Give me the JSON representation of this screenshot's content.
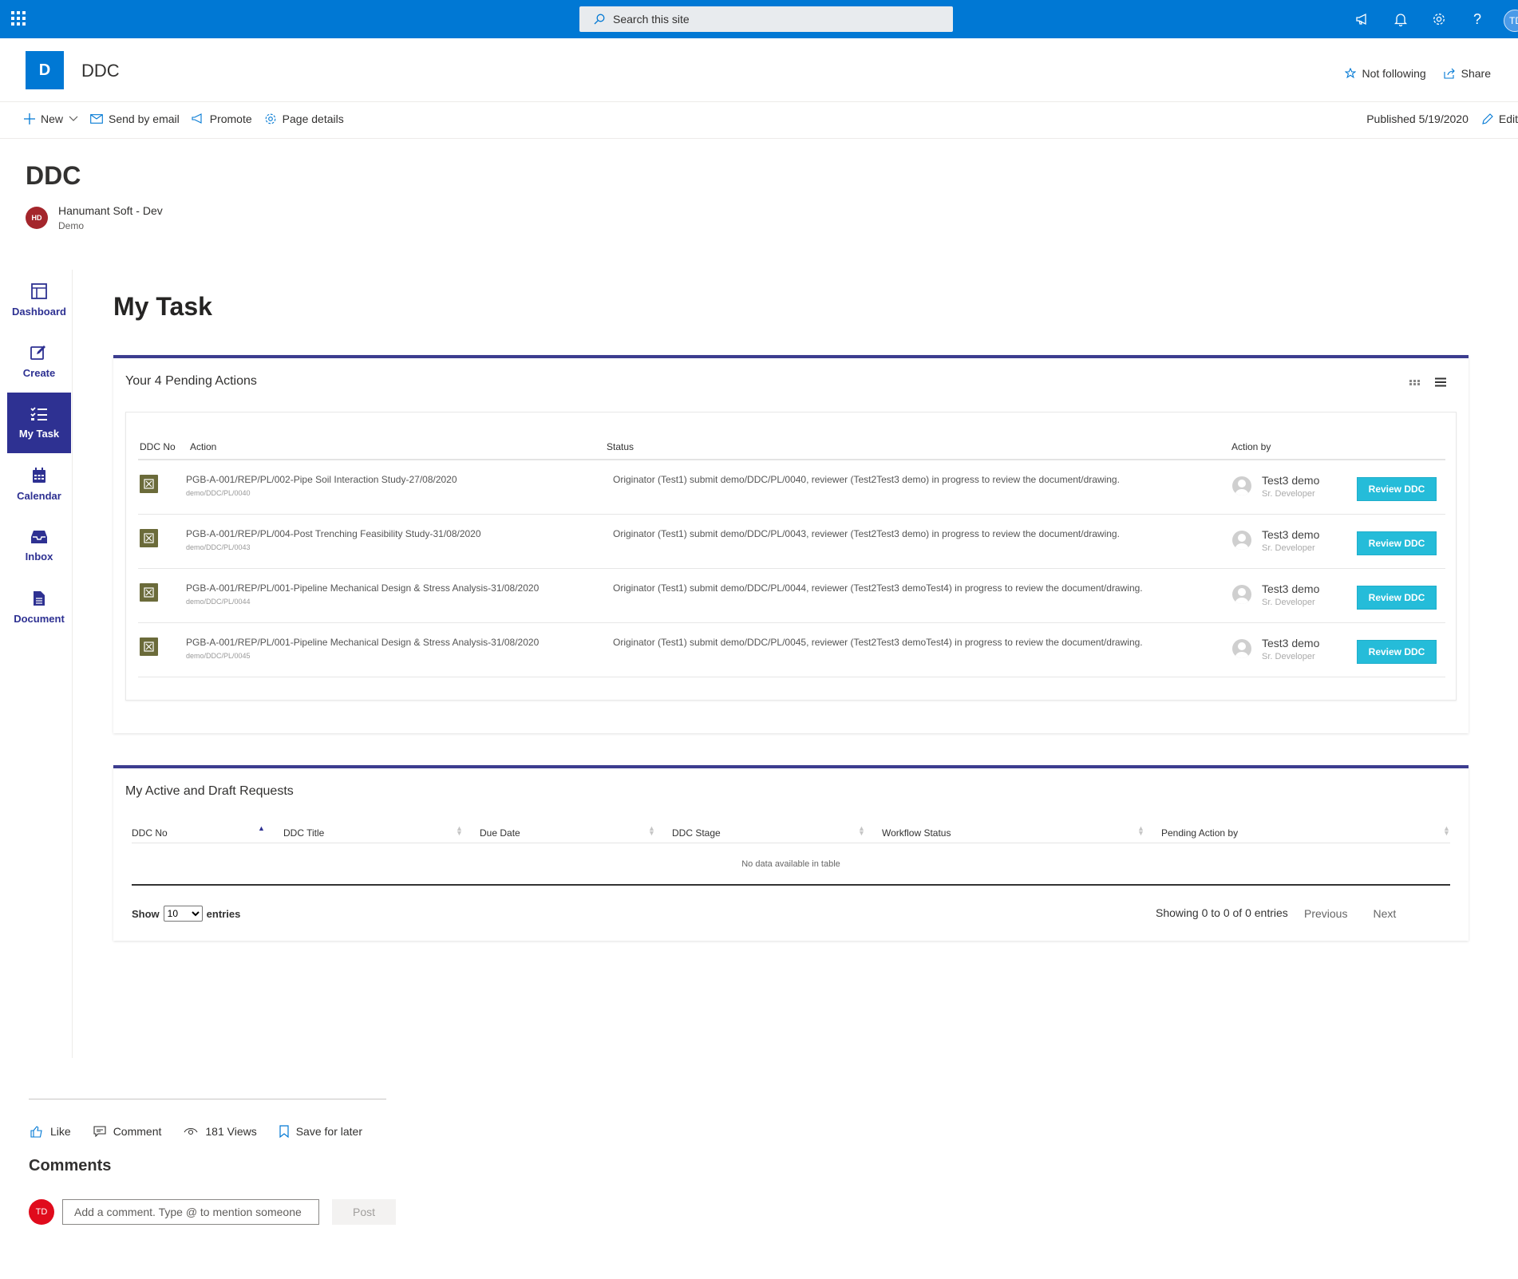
{
  "suitebar": {
    "search_placeholder": "Search this site",
    "avatar_initials": "TD"
  },
  "site": {
    "logo_letter": "D",
    "title": "DDC",
    "follow_label": "Not following",
    "share_label": "Share"
  },
  "commandbar": {
    "new_label": "New",
    "send_label": "Send by email",
    "promote_label": "Promote",
    "details_label": "Page details",
    "published_label": "Published 5/19/2020",
    "edit_label": "Edit"
  },
  "page": {
    "title": "DDC",
    "author_initials": "HD",
    "author_name": "Hanumant Soft - Dev",
    "author_sub": "Demo"
  },
  "nav": {
    "items": [
      {
        "label": "Dashboard"
      },
      {
        "label": "Create"
      },
      {
        "label": "My Task"
      },
      {
        "label": "Calendar"
      },
      {
        "label": "Inbox"
      },
      {
        "label": "Document"
      }
    ]
  },
  "main": {
    "heading": "My Task"
  },
  "pending": {
    "title": "Your 4 Pending Actions",
    "columns": {
      "ddc_no": "DDC No",
      "action": "Action",
      "status": "Status",
      "action_by": "Action by"
    },
    "rows": [
      {
        "title": "PGB-A-001/REP/PL/002-Pipe Soil Interaction Study-27/08/2020",
        "sub": "demo/DDC/PL/0040",
        "status": "Originator (Test1) submit demo/DDC/PL/0040, reviewer (Test2Test3 demo) in progress to review the document/drawing.",
        "user": "Test3 demo",
        "role": "Sr. Developer",
        "button": "Review DDC"
      },
      {
        "title": "PGB-A-001/REP/PL/004-Post Trenching Feasibility Study-31/08/2020",
        "sub": "demo/DDC/PL/0043",
        "status": "Originator (Test1) submit demo/DDC/PL/0043, reviewer (Test2Test3 demo) in progress to review the document/drawing.",
        "user": "Test3 demo",
        "role": "Sr. Developer",
        "button": "Review DDC"
      },
      {
        "title": "PGB-A-001/REP/PL/001-Pipeline Mechanical Design & Stress Analysis-31/08/2020",
        "sub": "demo/DDC/PL/0044",
        "status": "Originator (Test1) submit demo/DDC/PL/0044, reviewer (Test2Test3 demoTest4) in progress to review the document/drawing.",
        "user": "Test3 demo",
        "role": "Sr. Developer",
        "button": "Review DDC"
      },
      {
        "title": "PGB-A-001/REP/PL/001-Pipeline Mechanical Design & Stress Analysis-31/08/2020",
        "sub": "demo/DDC/PL/0045",
        "status": "Originator (Test1) submit demo/DDC/PL/0045, reviewer (Test2Test3 demoTest4) in progress to review the document/drawing.",
        "user": "Test3 demo",
        "role": "Sr. Developer",
        "button": "Review DDC"
      }
    ]
  },
  "requests": {
    "title": "My Active and Draft Requests",
    "columns": [
      "DDC No",
      "DDC Title",
      "Due Date",
      "DDC Stage",
      "Workflow Status",
      "Pending Action by"
    ],
    "empty_text": "No data available in table",
    "show_label": "Show",
    "entries_value": "10",
    "entries_label": "entries",
    "showing_text": "Showing 0 to 0 of 0 entries",
    "previous_label": "Previous",
    "next_label": "Next"
  },
  "social": {
    "like_label": "Like",
    "comment_label": "Comment",
    "views_label": "181 Views",
    "save_label": "Save for later",
    "comments_title": "Comments",
    "commenter_initials": "TD",
    "comment_placeholder": "Add a comment. Type @ to mention someone",
    "post_label": "Post"
  },
  "colors": {
    "suite_blue": "#0078d4",
    "nav_indigo": "#2e3192",
    "review_button": "#25bcd9"
  }
}
